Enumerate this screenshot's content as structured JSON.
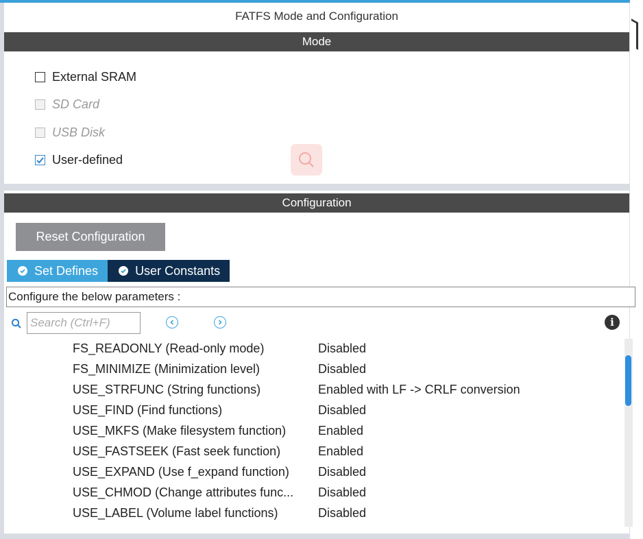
{
  "window": {
    "title": "FATFS Mode and Configuration"
  },
  "mode": {
    "header": "Mode",
    "items": [
      {
        "label": "External SRAM",
        "checked": false,
        "enabled": true
      },
      {
        "label": "SD Card",
        "checked": false,
        "enabled": false
      },
      {
        "label": "USB Disk",
        "checked": false,
        "enabled": false
      },
      {
        "label": "User-defined",
        "checked": true,
        "enabled": true
      }
    ]
  },
  "configuration": {
    "header": "Configuration",
    "reset_label": "Reset Configuration",
    "tabs": [
      {
        "label": "Set Defines",
        "active": true
      },
      {
        "label": "User Constants",
        "active": false
      }
    ],
    "hint": "Configure the below parameters :",
    "search": {
      "placeholder": "Search (Ctrl+F)",
      "value": ""
    },
    "params": [
      {
        "name": "FS_READONLY (Read-only mode)",
        "value": "Disabled"
      },
      {
        "name": "FS_MINIMIZE (Minimization level)",
        "value": "Disabled"
      },
      {
        "name": "USE_STRFUNC (String functions)",
        "value": "Enabled with LF -> CRLF conversion"
      },
      {
        "name": "USE_FIND (Find functions)",
        "value": "Disabled"
      },
      {
        "name": "USE_MKFS (Make filesystem function)",
        "value": "Enabled"
      },
      {
        "name": "USE_FASTSEEK (Fast seek function)",
        "value": "Enabled"
      },
      {
        "name": "USE_EXPAND (Use f_expand function)",
        "value": "Disabled"
      },
      {
        "name": "USE_CHMOD (Change attributes func...",
        "value": "Disabled"
      },
      {
        "name": "USE_LABEL (Volume label functions)",
        "value": "Disabled"
      }
    ]
  },
  "icons": {
    "search": "search-icon",
    "prev": "chevron-left-circle-icon",
    "next": "chevron-right-circle-icon",
    "info": "info-icon",
    "check": "check-icon"
  },
  "colors": {
    "accent": "#3ea5dc",
    "tab_inactive": "#0e2d4e",
    "section_bar": "#4a4a4a",
    "reset_button": "#8e9094",
    "scroll_thumb": "#2e8ee0"
  }
}
